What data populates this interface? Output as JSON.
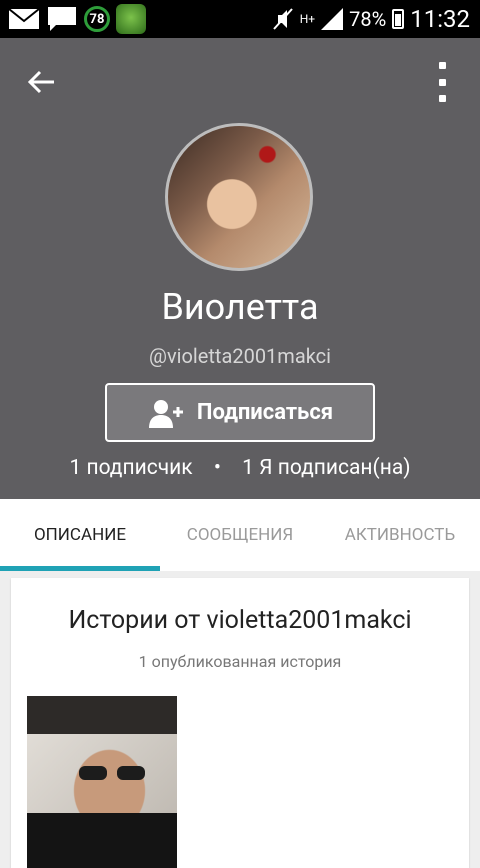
{
  "status_bar": {
    "badge_count": "78",
    "battery": "78%",
    "time": "11:32",
    "network": "H+"
  },
  "profile": {
    "name": "Виолетта",
    "handle": "@violetta2001makci",
    "follow_label": "Подписаться",
    "followers": "1 подписчик",
    "separator": "•",
    "following": "1 Я подписан(на)"
  },
  "tabs": [
    {
      "label": "ОПИСАНИЕ",
      "active": true
    },
    {
      "label": "СООБЩЕНИЯ",
      "active": false
    },
    {
      "label": "АКТИВНОСТЬ",
      "active": false
    }
  ],
  "stories": {
    "title": "Истории от violetta2001makci",
    "count": "1 опубликованная история"
  },
  "colors": {
    "header_bg": "#5f5e61",
    "tab_indicator": "#1fa2b5"
  }
}
